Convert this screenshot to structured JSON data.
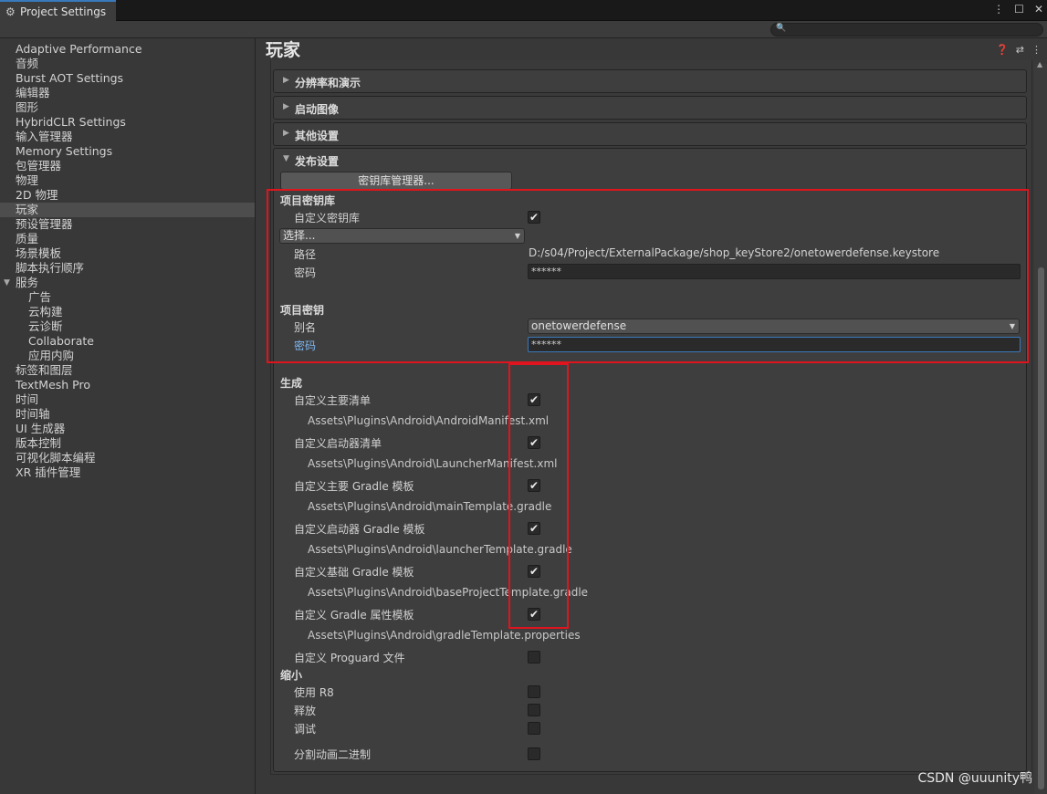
{
  "window": {
    "tab_title": "Project Settings",
    "tab_icon": "gear-icon",
    "controls": [
      "⋮",
      "☐",
      "✕"
    ]
  },
  "search": {
    "placeholder": ""
  },
  "sidebar": {
    "items": [
      {
        "label": "Adaptive Performance"
      },
      {
        "label": "音频"
      },
      {
        "label": "Burst AOT Settings"
      },
      {
        "label": "编辑器"
      },
      {
        "label": "图形"
      },
      {
        "label": "HybridCLR Settings"
      },
      {
        "label": "输入管理器"
      },
      {
        "label": "Memory Settings"
      },
      {
        "label": "包管理器"
      },
      {
        "label": "物理"
      },
      {
        "label": "2D 物理"
      },
      {
        "label": "玩家",
        "selected": true
      },
      {
        "label": "预设管理器"
      },
      {
        "label": "质量"
      },
      {
        "label": "场景模板"
      },
      {
        "label": "脚本执行顺序"
      },
      {
        "label": "服务",
        "expanded": true
      },
      {
        "label": "广告",
        "indent": 1
      },
      {
        "label": "云构建",
        "indent": 1
      },
      {
        "label": "云诊断",
        "indent": 1
      },
      {
        "label": "Collaborate",
        "indent": 1
      },
      {
        "label": "应用内购",
        "indent": 1
      },
      {
        "label": "标签和图层"
      },
      {
        "label": "TextMesh Pro"
      },
      {
        "label": "时间"
      },
      {
        "label": "时间轴"
      },
      {
        "label": "UI 生成器"
      },
      {
        "label": "版本控制"
      },
      {
        "label": "可视化脚本编程"
      },
      {
        "label": "XR 插件管理"
      }
    ]
  },
  "main": {
    "title": "玩家",
    "foldouts": [
      "分辨率和演示",
      "启动图像",
      "其他设置"
    ],
    "publishing": {
      "label": "发布设置",
      "keystore_manager_button": "密钥库管理器...",
      "project_keystore": {
        "heading": "项目密钥库",
        "custom_keystore_label": "自定义密钥库",
        "custom_keystore_checked": true,
        "select_dropdown": "选择...",
        "path_label": "路径",
        "path_value": "D:/s04/Project/ExternalPackage/shop_keyStore2/onetowerdefense.keystore",
        "password_label": "密码",
        "password_value": "******"
      },
      "project_key": {
        "heading": "项目密钥",
        "alias_label": "别名",
        "alias_value": "onetowerdefense",
        "password_label": "密码",
        "password_value": "******"
      },
      "build": {
        "heading": "生成",
        "rows": [
          {
            "label": "自定义主要清单",
            "checked": true,
            "path": "Assets\\Plugins\\Android\\AndroidManifest.xml"
          },
          {
            "label": "自定义启动器清单",
            "checked": true,
            "path": "Assets\\Plugins\\Android\\LauncherManifest.xml"
          },
          {
            "label": "自定义主要 Gradle 模板",
            "checked": true,
            "path": "Assets\\Plugins\\Android\\mainTemplate.gradle"
          },
          {
            "label": "自定义启动器 Gradle 模板",
            "checked": true,
            "path": "Assets\\Plugins\\Android\\launcherTemplate.gradle"
          },
          {
            "label": "自定义基础 Gradle 模板",
            "checked": true,
            "path": "Assets\\Plugins\\Android\\baseProjectTemplate.gradle"
          },
          {
            "label": "自定义 Gradle 属性模板",
            "checked": true,
            "path": "Assets\\Plugins\\Android\\gradleTemplate.properties"
          }
        ],
        "proguard_label": "自定义 Proguard 文件",
        "proguard_checked": false
      },
      "minify": {
        "heading": "缩小",
        "use_r8_label": "使用 R8",
        "release_label": "释放",
        "debug_label": "调试"
      },
      "split_binary_label": "分割动画二进制"
    }
  },
  "watermark": "CSDN @uuunity鸭"
}
